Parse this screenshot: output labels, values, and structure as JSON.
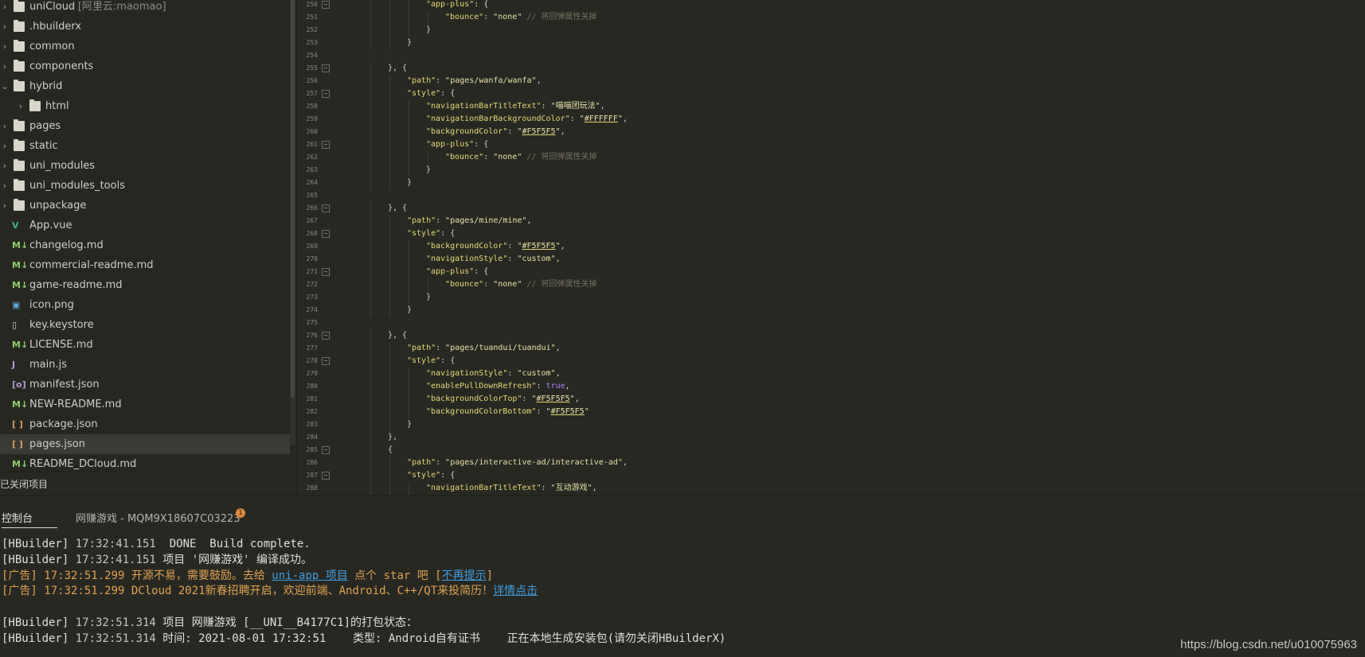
{
  "sidebar": {
    "items": [
      {
        "label": "uniCloud",
        "suffix": " - [阿里云:maomao]",
        "type": "folder",
        "expanded": false,
        "depth": 0
      },
      {
        "label": ".hbuilderx",
        "type": "folder",
        "expanded": false,
        "depth": 0
      },
      {
        "label": "common",
        "type": "folder",
        "expanded": false,
        "depth": 0
      },
      {
        "label": "components",
        "type": "folder",
        "expanded": false,
        "depth": 0
      },
      {
        "label": "hybrid",
        "type": "folder",
        "expanded": true,
        "depth": 0
      },
      {
        "label": "html",
        "type": "folder",
        "expanded": false,
        "depth": 1
      },
      {
        "label": "pages",
        "type": "folder",
        "expanded": false,
        "depth": 0
      },
      {
        "label": "static",
        "type": "folder",
        "expanded": false,
        "depth": 0
      },
      {
        "label": "uni_modules",
        "type": "folder",
        "expanded": false,
        "depth": 0
      },
      {
        "label": "uni_modules_tools",
        "type": "folder",
        "expanded": false,
        "depth": 0
      },
      {
        "label": "unpackage",
        "type": "folder",
        "expanded": false,
        "depth": 0
      },
      {
        "label": "App.vue",
        "type": "vue",
        "depth": 0
      },
      {
        "label": "changelog.md",
        "type": "md",
        "depth": 0
      },
      {
        "label": "commercial-readme.md",
        "type": "md",
        "depth": 0
      },
      {
        "label": "game-readme.md",
        "type": "md",
        "depth": 0
      },
      {
        "label": "icon.png",
        "type": "image",
        "depth": 0
      },
      {
        "label": "key.keystore",
        "type": "file",
        "depth": 0
      },
      {
        "label": "LICENSE.md",
        "type": "md",
        "depth": 0
      },
      {
        "label": "main.js",
        "type": "js",
        "depth": 0
      },
      {
        "label": "manifest.json",
        "type": "manifest",
        "depth": 0
      },
      {
        "label": "NEW-README.md",
        "type": "md",
        "depth": 0
      },
      {
        "label": "package.json",
        "type": "json",
        "depth": 0
      },
      {
        "label": "pages.json",
        "type": "json",
        "depth": 0,
        "selected": true
      },
      {
        "label": "README_DCloud.md",
        "type": "md",
        "depth": 0
      }
    ],
    "closed_projects_label": "已关闭项目"
  },
  "editor": {
    "lines": [
      {
        "num": "250",
        "fold": true,
        "indent": 4,
        "tokens": [
          [
            "k",
            "\"app-plus\""
          ],
          [
            "p",
            ": {"
          ]
        ]
      },
      {
        "num": "251",
        "fold": false,
        "indent": 5,
        "tokens": [
          [
            "k",
            "\"bounce\""
          ],
          [
            "p",
            ": "
          ],
          [
            "str",
            "\"none\""
          ],
          [
            "p",
            " "
          ],
          [
            "c",
            "// 将回弹属性关掉"
          ]
        ]
      },
      {
        "num": "252",
        "fold": false,
        "indent": 4,
        "tokens": [
          [
            "p",
            "}"
          ]
        ]
      },
      {
        "num": "253",
        "fold": false,
        "indent": 3,
        "tokens": [
          [
            "p",
            "}"
          ]
        ]
      },
      {
        "num": "254",
        "fold": false,
        "indent": 0,
        "tokens": []
      },
      {
        "num": "255",
        "fold": true,
        "indent": 2,
        "tokens": [
          [
            "p",
            "}, {"
          ]
        ]
      },
      {
        "num": "256",
        "fold": false,
        "indent": 3,
        "tokens": [
          [
            "k",
            "\"path\""
          ],
          [
            "p",
            ": "
          ],
          [
            "str",
            "\"pages/wanfa/wanfa\""
          ],
          [
            "p",
            ","
          ]
        ]
      },
      {
        "num": "257",
        "fold": true,
        "indent": 3,
        "tokens": [
          [
            "k",
            "\"style\""
          ],
          [
            "p",
            ": {"
          ]
        ]
      },
      {
        "num": "258",
        "fold": false,
        "indent": 4,
        "tokens": [
          [
            "k",
            "\"navigationBarTitleText\""
          ],
          [
            "p",
            ": "
          ],
          [
            "str",
            "\"喵喵团玩法\""
          ],
          [
            "p",
            ","
          ]
        ]
      },
      {
        "num": "259",
        "fold": false,
        "indent": 4,
        "tokens": [
          [
            "k",
            "\"navigationBarBackgroundColor\""
          ],
          [
            "p",
            ": "
          ],
          [
            "str",
            "\""
          ],
          [
            "u",
            "#FFFFFF"
          ],
          [
            "str",
            "\""
          ],
          [
            "p",
            ","
          ]
        ]
      },
      {
        "num": "260",
        "fold": false,
        "indent": 4,
        "tokens": [
          [
            "k",
            "\"backgroundColor\""
          ],
          [
            "p",
            ": "
          ],
          [
            "str",
            "\""
          ],
          [
            "u",
            "#F5F5F5"
          ],
          [
            "str",
            "\""
          ],
          [
            "p",
            ","
          ]
        ]
      },
      {
        "num": "261",
        "fold": true,
        "indent": 4,
        "tokens": [
          [
            "k",
            "\"app-plus\""
          ],
          [
            "p",
            ": {"
          ]
        ]
      },
      {
        "num": "262",
        "fold": false,
        "indent": 5,
        "tokens": [
          [
            "k",
            "\"bounce\""
          ],
          [
            "p",
            ": "
          ],
          [
            "str",
            "\"none\""
          ],
          [
            "p",
            " "
          ],
          [
            "c",
            "// 将回弹属性关掉"
          ]
        ]
      },
      {
        "num": "263",
        "fold": false,
        "indent": 4,
        "tokens": [
          [
            "p",
            "}"
          ]
        ]
      },
      {
        "num": "264",
        "fold": false,
        "indent": 3,
        "tokens": [
          [
            "p",
            "}"
          ]
        ]
      },
      {
        "num": "265",
        "fold": false,
        "indent": 0,
        "tokens": []
      },
      {
        "num": "266",
        "fold": true,
        "indent": 2,
        "tokens": [
          [
            "p",
            "}, {"
          ]
        ]
      },
      {
        "num": "267",
        "fold": false,
        "indent": 3,
        "tokens": [
          [
            "k",
            "\"path\""
          ],
          [
            "p",
            ": "
          ],
          [
            "str",
            "\"pages/mine/mine\""
          ],
          [
            "p",
            ","
          ]
        ]
      },
      {
        "num": "268",
        "fold": true,
        "indent": 3,
        "tokens": [
          [
            "k",
            "\"style\""
          ],
          [
            "p",
            ": {"
          ]
        ]
      },
      {
        "num": "269",
        "fold": false,
        "indent": 4,
        "tokens": [
          [
            "k",
            "\"backgroundColor\""
          ],
          [
            "p",
            ": "
          ],
          [
            "str",
            "\""
          ],
          [
            "u",
            "#F5F5F5"
          ],
          [
            "str",
            "\""
          ],
          [
            "p",
            ","
          ]
        ]
      },
      {
        "num": "270",
        "fold": false,
        "indent": 4,
        "tokens": [
          [
            "k",
            "\"navigationStyle\""
          ],
          [
            "p",
            ": "
          ],
          [
            "str",
            "\"custom\""
          ],
          [
            "p",
            ","
          ]
        ]
      },
      {
        "num": "271",
        "fold": true,
        "indent": 4,
        "tokens": [
          [
            "k",
            "\"app-plus\""
          ],
          [
            "p",
            ": {"
          ]
        ]
      },
      {
        "num": "272",
        "fold": false,
        "indent": 5,
        "tokens": [
          [
            "k",
            "\"bounce\""
          ],
          [
            "p",
            ": "
          ],
          [
            "str",
            "\"none\""
          ],
          [
            "p",
            " "
          ],
          [
            "c",
            "// 将回弹属性关掉"
          ]
        ]
      },
      {
        "num": "273",
        "fold": false,
        "indent": 4,
        "tokens": [
          [
            "p",
            "}"
          ]
        ]
      },
      {
        "num": "274",
        "fold": false,
        "indent": 3,
        "tokens": [
          [
            "p",
            "}"
          ]
        ]
      },
      {
        "num": "275",
        "fold": false,
        "indent": 0,
        "tokens": []
      },
      {
        "num": "276",
        "fold": true,
        "indent": 2,
        "tokens": [
          [
            "p",
            "}, {"
          ]
        ]
      },
      {
        "num": "277",
        "fold": false,
        "indent": 3,
        "tokens": [
          [
            "k",
            "\"path\""
          ],
          [
            "p",
            ": "
          ],
          [
            "str",
            "\"pages/tuandui/tuandui\""
          ],
          [
            "p",
            ","
          ]
        ]
      },
      {
        "num": "278",
        "fold": true,
        "indent": 3,
        "tokens": [
          [
            "k",
            "\"style\""
          ],
          [
            "p",
            ": {"
          ]
        ]
      },
      {
        "num": "279",
        "fold": false,
        "indent": 4,
        "tokens": [
          [
            "k",
            "\"navigationStyle\""
          ],
          [
            "p",
            ": "
          ],
          [
            "str",
            "\"custom\""
          ],
          [
            "p",
            ","
          ]
        ]
      },
      {
        "num": "280",
        "fold": false,
        "indent": 4,
        "tokens": [
          [
            "k",
            "\"enablePullDownRefresh\""
          ],
          [
            "p",
            ": "
          ],
          [
            "kw",
            "true"
          ],
          [
            "p",
            ","
          ]
        ]
      },
      {
        "num": "281",
        "fold": false,
        "indent": 4,
        "tokens": [
          [
            "k",
            "\"backgroundColorTop\""
          ],
          [
            "p",
            ": "
          ],
          [
            "str",
            "\""
          ],
          [
            "u",
            "#F5F5F5"
          ],
          [
            "str",
            "\""
          ],
          [
            "p",
            ","
          ]
        ]
      },
      {
        "num": "282",
        "fold": false,
        "indent": 4,
        "tokens": [
          [
            "k",
            "\"backgroundColorBottom\""
          ],
          [
            "p",
            ": "
          ],
          [
            "str",
            "\""
          ],
          [
            "u",
            "#F5F5F5"
          ],
          [
            "str",
            "\""
          ]
        ]
      },
      {
        "num": "283",
        "fold": false,
        "indent": 3,
        "tokens": [
          [
            "p",
            "}"
          ]
        ]
      },
      {
        "num": "284",
        "fold": false,
        "indent": 2,
        "tokens": [
          [
            "p",
            "},"
          ]
        ]
      },
      {
        "num": "285",
        "fold": true,
        "indent": 2,
        "tokens": [
          [
            "p",
            "{"
          ]
        ]
      },
      {
        "num": "286",
        "fold": false,
        "indent": 3,
        "tokens": [
          [
            "k",
            "\"path\""
          ],
          [
            "p",
            ": "
          ],
          [
            "str",
            "\"pages/interactive-ad/interactive-ad\""
          ],
          [
            "p",
            ","
          ]
        ]
      },
      {
        "num": "287",
        "fold": true,
        "indent": 3,
        "tokens": [
          [
            "k",
            "\"style\""
          ],
          [
            "p",
            ": {"
          ]
        ]
      },
      {
        "num": "288",
        "fold": false,
        "indent": 4,
        "tokens": [
          [
            "k",
            "\"navigationBarTitleText\""
          ],
          [
            "p",
            ": "
          ],
          [
            "str",
            "\"互动游戏\""
          ],
          [
            "p",
            ","
          ]
        ]
      }
    ]
  },
  "console": {
    "tabs": [
      {
        "label": "控制台",
        "active": true
      },
      {
        "label": "网赚游戏 - MQM9X18607C03223",
        "active": false,
        "badge": "1"
      }
    ],
    "lines": [
      {
        "row": 0,
        "kind": "normal",
        "parts": [
          [
            "t",
            "[HBuilder] "
          ],
          [
            "ts",
            "17:32:41.151"
          ],
          [
            "t",
            "  DONE  Build complete."
          ]
        ]
      },
      {
        "row": 1,
        "kind": "normal",
        "parts": [
          [
            "t",
            "[HBuilder] "
          ],
          [
            "ts",
            "17:32:41.151"
          ],
          [
            "t",
            " 项目 '网赚游戏' 编译成功。"
          ]
        ]
      },
      {
        "row": 2,
        "kind": "ad",
        "parts": [
          [
            "t",
            "[广告] 17:32:51.299 开源不易，需要鼓励。去给 "
          ],
          [
            "link",
            "uni-app 项目"
          ],
          [
            "t",
            " 点个 star 吧 ["
          ],
          [
            "link",
            "不再提示"
          ],
          [
            "t",
            "]"
          ]
        ]
      },
      {
        "row": 3,
        "kind": "ad",
        "parts": [
          [
            "t",
            "[广告] 17:32:51.299 DCloud 2021新春招聘开启，欢迎前端、Android、C++/QT来投简历！"
          ],
          [
            "link",
            "详情点击"
          ]
        ]
      },
      {
        "row": 5,
        "kind": "normal",
        "parts": [
          [
            "t",
            "[HBuilder] "
          ],
          [
            "ts",
            "17:32:51.314"
          ],
          [
            "t",
            " 项目 网赚游戏 [__UNI__B4177C1]的打包状态："
          ]
        ]
      },
      {
        "row": 6,
        "kind": "normal",
        "parts": [
          [
            "t",
            "[HBuilder] "
          ],
          [
            "ts",
            "17:32:51.314"
          ],
          [
            "t",
            " 时间: 2021-08-01 17:32:51    类型: Android自有证书    正在本地生成安装包(请勿关闭HBuilderX)"
          ]
        ]
      }
    ],
    "watermark": "https://blog.csdn.net/u010075963"
  },
  "colors": {
    "background": "#272822",
    "key": "#e6db74",
    "keyword": "#ae81ff",
    "comment": "#75715e",
    "link": "#3fa0e6",
    "ad": "#e3a24f"
  }
}
